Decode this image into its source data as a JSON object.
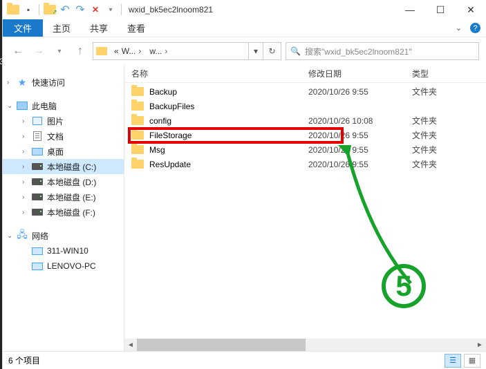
{
  "window": {
    "title": "wxid_bk5ec2lnoom821"
  },
  "ribbon": {
    "file": "文件",
    "tabs": [
      "主页",
      "共享",
      "查看"
    ]
  },
  "nav": {
    "crumb1": "W...",
    "crumb2": "w..."
  },
  "search": {
    "placeholder": "搜索\"wxid_bk5ec2lnoom821\""
  },
  "sidebar": {
    "quick": "快速访问",
    "pc": "此电脑",
    "pictures": "图片",
    "documents": "文档",
    "desktop": "桌面",
    "driveC": "本地磁盘 (C:)",
    "driveD": "本地磁盘 (D:)",
    "driveE": "本地磁盘 (E:)",
    "driveF": "本地磁盘 (F:)",
    "network": "网络",
    "host1": "311-WIN10",
    "host2": "LENOVO-PC"
  },
  "columns": {
    "name": "名称",
    "date": "修改日期",
    "type": "类型"
  },
  "rows": [
    {
      "name": "Backup",
      "date": "2020/10/26 9:55",
      "type": "文件夹"
    },
    {
      "name": "BackupFiles",
      "date": "",
      "type": ""
    },
    {
      "name": "config",
      "date": "2020/10/26 10:08",
      "type": "文件夹"
    },
    {
      "name": "FileStorage",
      "date": "2020/10/26 9:55",
      "type": "文件夹"
    },
    {
      "name": "Msg",
      "date": "2020/10/26 9:55",
      "type": "文件夹"
    },
    {
      "name": "ResUpdate",
      "date": "2020/10/26 9:55",
      "type": "文件夹"
    }
  ],
  "status": {
    "count": "6 个项目"
  },
  "annotation": {
    "step": "5"
  }
}
